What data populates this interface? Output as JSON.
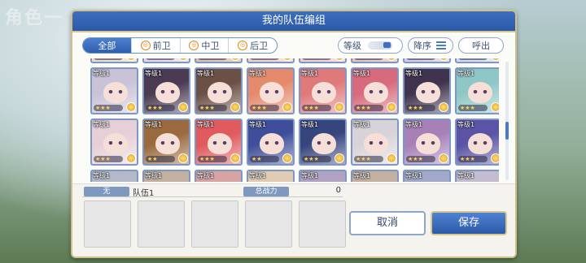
{
  "background": {
    "title": "角色一"
  },
  "dialog": {
    "title": "我的队伍编组"
  },
  "filters": [
    {
      "label": "全部",
      "icon": "",
      "active": true
    },
    {
      "label": "前卫",
      "icon": "front-position-icon",
      "active": false
    },
    {
      "label": "中卫",
      "icon": "middle-position-icon",
      "active": false
    },
    {
      "label": "后卫",
      "icon": "back-position-icon",
      "active": false
    }
  ],
  "sort": {
    "field_label": "等级",
    "order_label": "降序",
    "callout_label": "呼出"
  },
  "roster": {
    "rows": [
      [
        {
          "level": "",
          "stars": "★★★",
          "color": "#e2d0a8"
        },
        {
          "level": "",
          "stars": "★★★",
          "color": "#d9c7de"
        },
        {
          "level": "",
          "stars": "★★★",
          "color": "#c9a68c"
        },
        {
          "level": "",
          "stars": "★★★",
          "color": "#e7c0b6"
        },
        {
          "level": "",
          "stars": "★★",
          "color": "#e8b9c3"
        },
        {
          "level": "",
          "stars": "★★★",
          "color": "#d8a8a8"
        },
        {
          "level": "",
          "stars": "★★★",
          "color": "#c6b6d6"
        },
        {
          "level": "",
          "stars": "★★★",
          "color": "#bfcde6"
        }
      ],
      [
        {
          "level": "等级1",
          "stars": "★★★",
          "color": "#c9c3d8"
        },
        {
          "level": "等级1",
          "stars": "★★★",
          "color": "#4a3a52"
        },
        {
          "level": "等级1",
          "stars": "★★★",
          "color": "#6b5046"
        },
        {
          "level": "等级1",
          "stars": "★★★",
          "color": "#e58a6c"
        },
        {
          "level": "等级1",
          "stars": "★★★",
          "color": "#e0797a"
        },
        {
          "level": "等级1",
          "stars": "★★★",
          "color": "#d86a7e"
        },
        {
          "level": "等级1",
          "stars": "★★★",
          "color": "#3f334d"
        },
        {
          "level": "等级1",
          "stars": "★★★",
          "color": "#8fc7c6"
        }
      ],
      [
        {
          "level": "等级1",
          "stars": "★★★",
          "color": "#e7cfd8"
        },
        {
          "level": "等级1",
          "stars": "★★",
          "color": "#9a6a3e"
        },
        {
          "level": "等级1",
          "stars": "★★★",
          "color": "#e05a5e"
        },
        {
          "level": "等级1",
          "stars": "★★",
          "color": "#3f4e9a"
        },
        {
          "level": "等级1",
          "stars": "★★★",
          "color": "#37457f"
        },
        {
          "level": "等级1",
          "stars": "★★★",
          "color": "#d8d3d8"
        },
        {
          "level": "等级1",
          "stars": "★★★",
          "color": "#a680b7"
        },
        {
          "level": "等级1",
          "stars": "★★★",
          "color": "#5b53a5"
        }
      ],
      [
        {
          "level": "等级1",
          "stars": "",
          "color": "#b4b9c9"
        },
        {
          "level": "等级1",
          "stars": "",
          "color": "#c2b0a0"
        },
        {
          "level": "等级1",
          "stars": "",
          "color": "#d7a3a3"
        },
        {
          "level": "等级1",
          "stars": "",
          "color": "#e0ccb5"
        },
        {
          "level": "等级1",
          "stars": "",
          "color": "#b0a2c2"
        },
        {
          "level": "等级1",
          "stars": "",
          "color": "#c3b0a0"
        },
        {
          "level": "等级1",
          "stars": "",
          "color": "#a1a8c9"
        },
        {
          "level": "等级1",
          "stars": "",
          "color": "#c4bdd2"
        }
      ]
    ]
  },
  "team": {
    "tag": "无",
    "name": "队伍1",
    "power_label": "总战力",
    "power_value": "0",
    "slots": 5
  },
  "buttons": {
    "cancel": "取消",
    "save": "保存"
  }
}
